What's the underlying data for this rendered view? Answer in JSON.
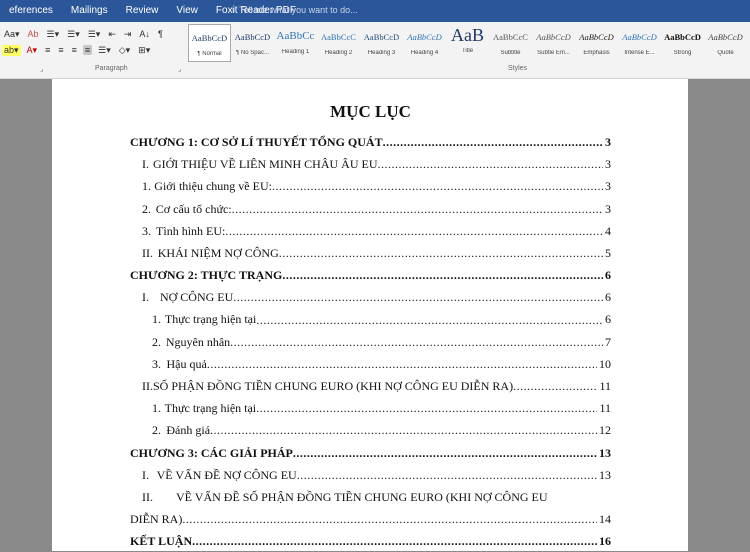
{
  "menu": [
    "eferences",
    "Mailings",
    "Review",
    "View",
    "Foxit Reader PDF"
  ],
  "tellme": "Tell me what you want to do...",
  "ribbon": {
    "row1": [
      "Aa▾",
      "Ab",
      "☰▾",
      "☰▾",
      "☰▾",
      "⇤",
      "⇥",
      "A↓",
      "¶"
    ],
    "row2": [
      "ab▾",
      "A▾",
      "≡",
      "≡",
      "≡",
      "≡",
      "☰▾",
      "◇▾",
      "⊞▾"
    ],
    "paragraph_label": "Paragraph",
    "styles_label": "Styles"
  },
  "styles": [
    {
      "preview": "AaBbCcD",
      "name": "¶ Normal"
    },
    {
      "preview": "AaBbCcD",
      "name": "¶ No Spac..."
    },
    {
      "preview": "AaBbCc",
      "name": "Heading 1"
    },
    {
      "preview": "AaBbCcC",
      "name": "Heading 2"
    },
    {
      "preview": "AaBbCcD",
      "name": "Heading 3"
    },
    {
      "preview": "AaBbCcD",
      "name": "Heading 4"
    },
    {
      "preview": "AaB",
      "name": "Title"
    },
    {
      "preview": "AaBbCcC",
      "name": "Subtitle"
    },
    {
      "preview": "AaBbCcD",
      "name": "Subtle Em..."
    },
    {
      "preview": "AaBbCcD",
      "name": "Emphasis"
    },
    {
      "preview": "AaBbCcD",
      "name": "Intense E..."
    },
    {
      "preview": "AaBbCcD",
      "name": "Strong"
    },
    {
      "preview": "AaBbCcD",
      "name": "Quote"
    }
  ],
  "toc": {
    "title": "MỤC LỤC",
    "entries": [
      {
        "level": 0,
        "label": "CHƯƠNG 1: CƠ SỞ LÍ THUYẾT TỔNG QUÁT",
        "page": "3"
      },
      {
        "level": 1,
        "num": "I.",
        "label": "GIỚI THIỆU VỀ LIÊN MINH CHÂU ÂU EU",
        "page": "3"
      },
      {
        "level": 2,
        "num": "1.",
        "label": "Giới thiệu chung về EU:",
        "page": "3"
      },
      {
        "level": 2,
        "num": "2.",
        "label": "Cơ cấu tổ chức:",
        "page": "3"
      },
      {
        "level": 2,
        "num": "3.",
        "label": "Tình hình EU:",
        "page": "4"
      },
      {
        "level": 1,
        "num": "II.",
        "label": "KHÁI NIỆM NỢ CÔNG",
        "page": "5"
      },
      {
        "level": 0,
        "label": "CHƯƠNG 2: THỰC TRẠNG",
        "page": "6"
      },
      {
        "level": 1,
        "num": "I.",
        "label": "NỢ CÔNG EU",
        "page": "6"
      },
      {
        "level": 3,
        "num": "1.",
        "label": "Thực trạng hiện tại",
        "page": "6"
      },
      {
        "level": 3,
        "num": "2.",
        "label": "Nguyên nhân",
        "page": "7"
      },
      {
        "level": 3,
        "num": "3.",
        "label": "Hậu quả",
        "page": "10"
      },
      {
        "level": 1,
        "num": "II.",
        "label": "SỐ PHẬN ĐỒNG TIỀN CHUNG EURO (KHI NỢ CÔNG EU DIỄN RA)",
        "page": "11"
      },
      {
        "level": 3,
        "num": "1.",
        "label": "Thực trạng hiện tại",
        "page": "11"
      },
      {
        "level": 3,
        "num": "2.",
        "label": "Đánh giá",
        "page": "12"
      },
      {
        "level": 0,
        "label": "CHƯƠNG 3: CÁC GIẢI PHÁP",
        "page": "13"
      },
      {
        "level": 1,
        "num": "I.",
        "label": "VỀ VẤN ĐỀ NỢ CÔNG EU",
        "page": "13"
      }
    ],
    "wrap_entry": {
      "num": "II.",
      "line1": "VỀ VẤN ĐỀ SỐ PHẬN ĐỒNG TIỀN CHUNG EURO (KHI NỢ CÔNG EU",
      "line2": "DIỄN RA)",
      "page": "14"
    },
    "final_entry": {
      "label": "KẾT LUẬN",
      "page": "16"
    }
  }
}
